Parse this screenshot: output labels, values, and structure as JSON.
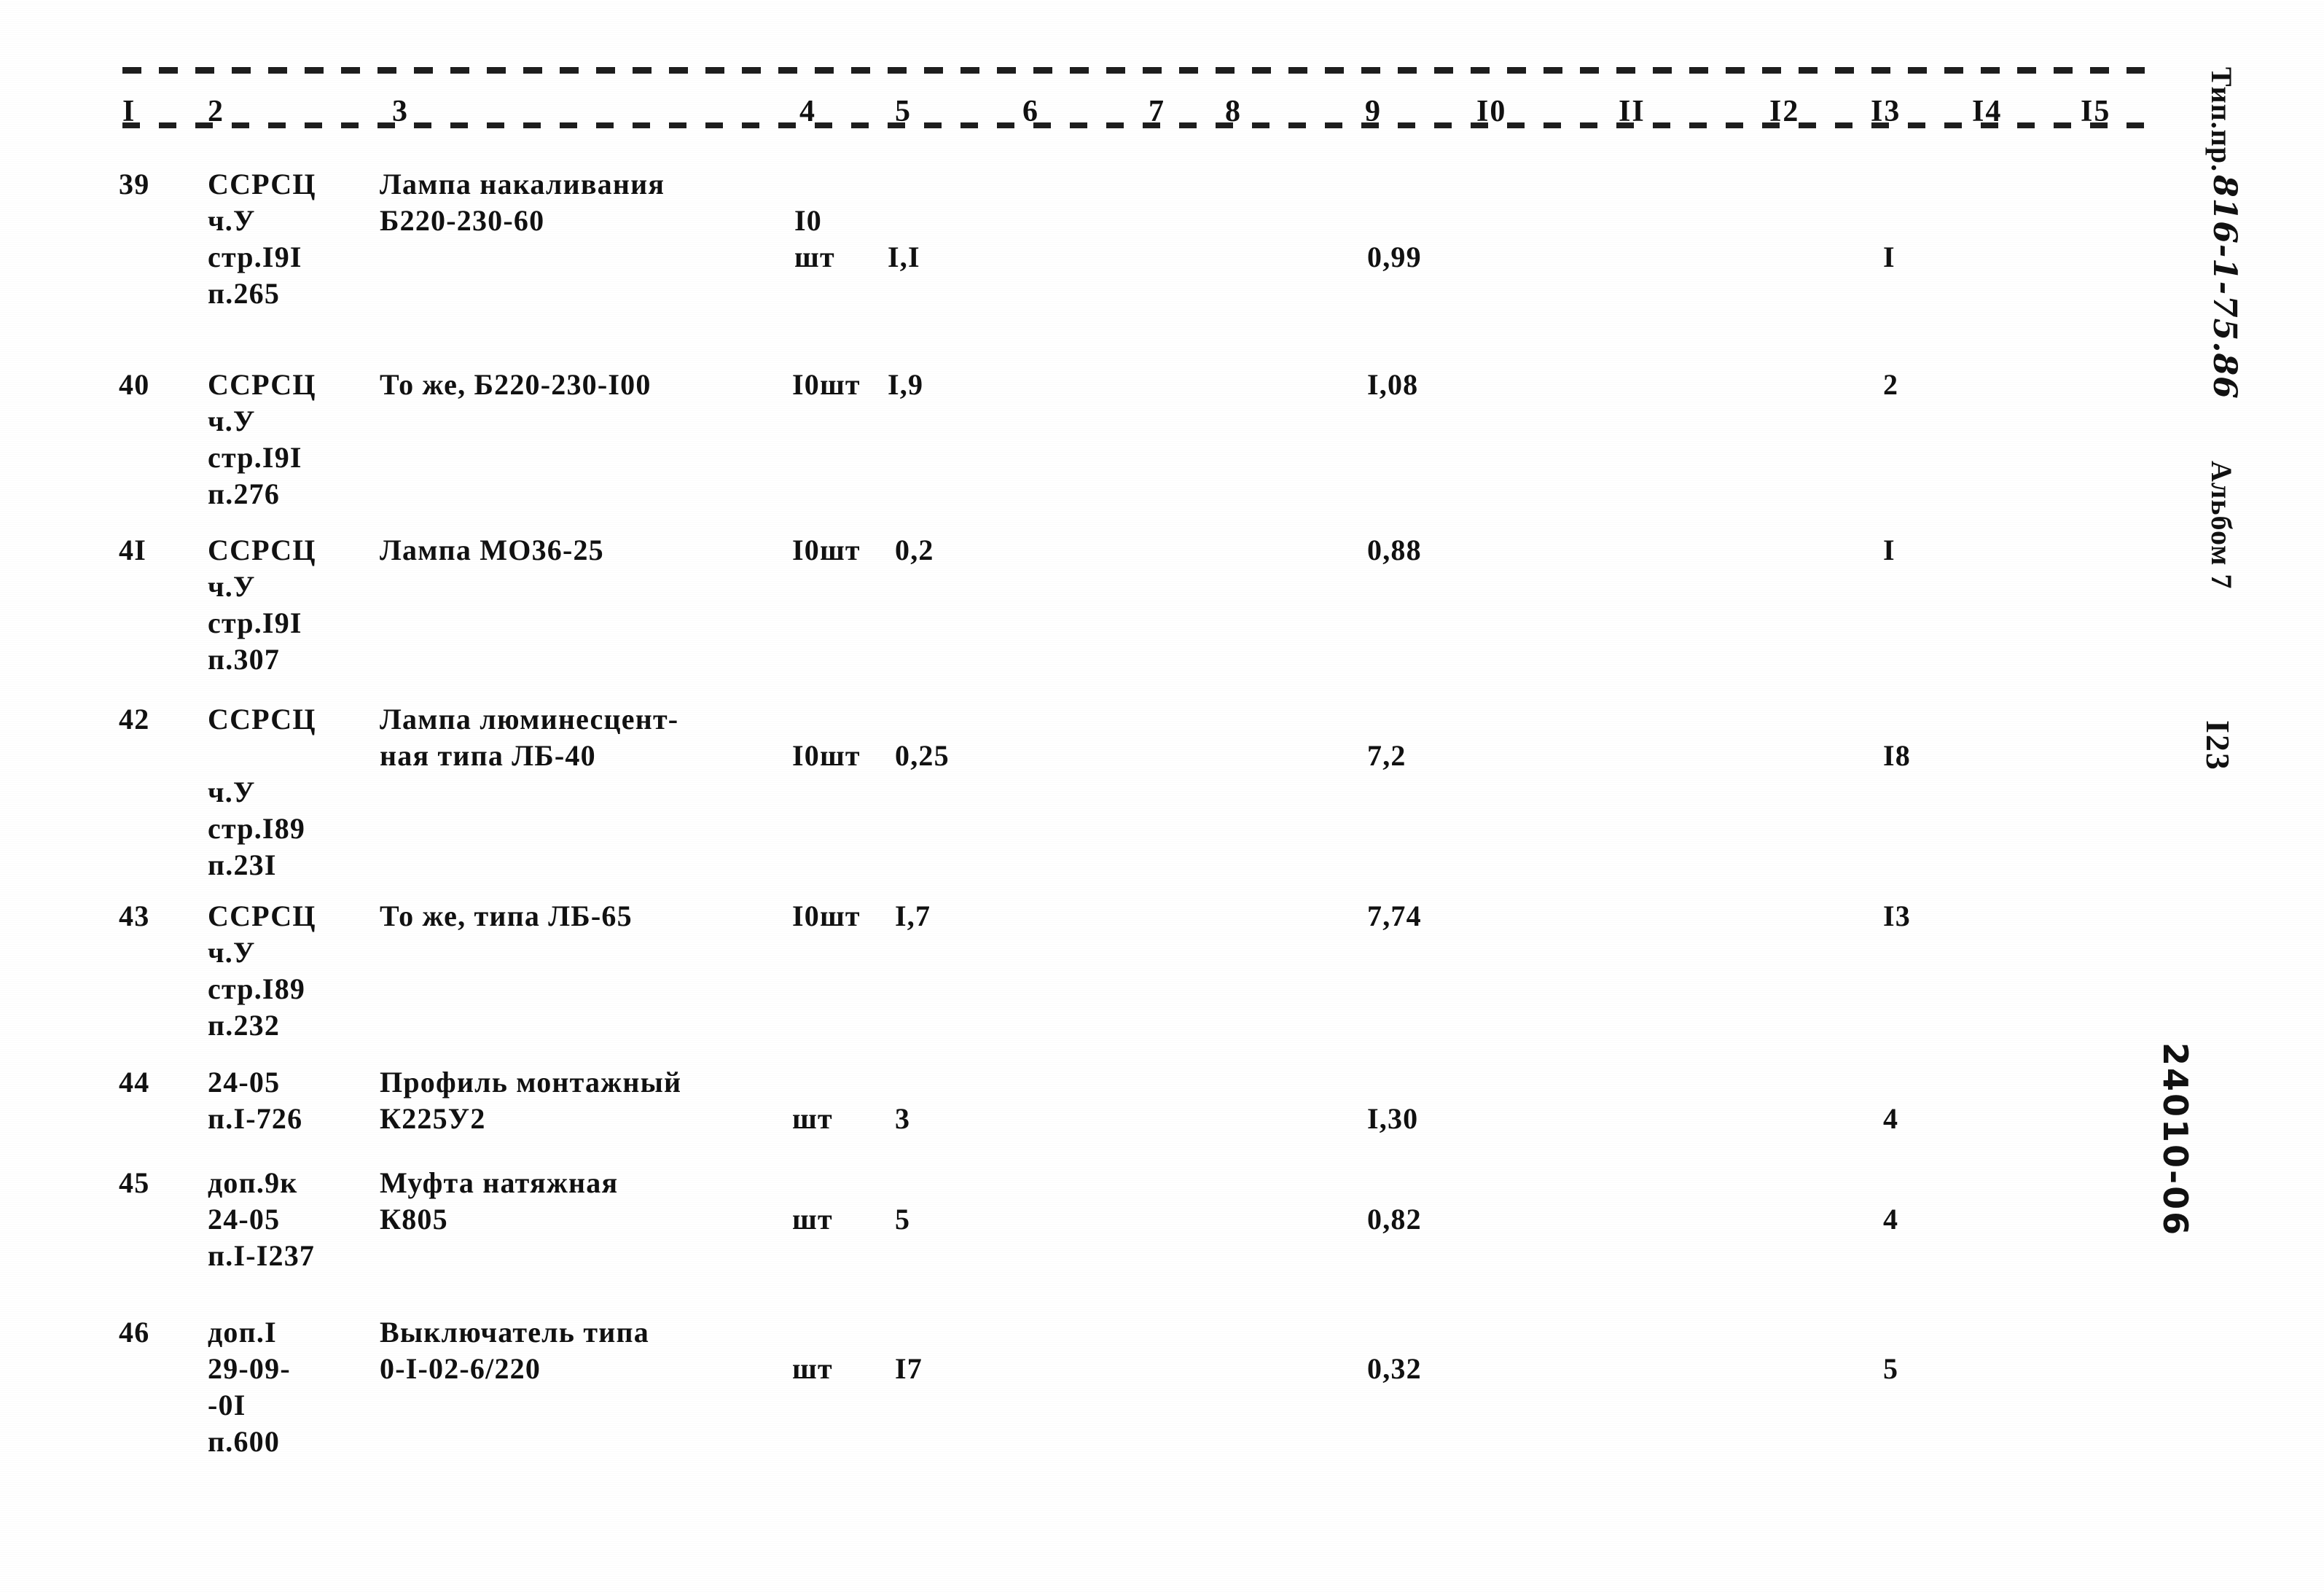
{
  "document": {
    "page_number": "I23",
    "margin_stamp_typed": "Тип.пр.",
    "margin_stamp_hand": "816-1-75.86",
    "margin_album": "Альбом 7",
    "margin_code": "24010-06"
  },
  "table": {
    "column_headers": [
      "I",
      "2",
      "3",
      "4",
      "5",
      "6",
      "7",
      "8",
      "9",
      "I0",
      "II",
      "I2",
      "I3",
      "I4",
      "I5"
    ],
    "rows": [
      {
        "num": "39",
        "ref": "ССРСЦ\nч.У\nстр.I9I\nп.265",
        "name": "Лампа накаливания\nБ220-230-60",
        "unit": "I0\nшт",
        "qty": "I,I",
        "col9": "0,99",
        "col13": "I"
      },
      {
        "num": "40",
        "ref": "ССРСЦ\nч.У\nстр.I9I\nп.276",
        "name": "То же, Б220-230-I00",
        "unit": "I0шт",
        "qty": "I,9",
        "col9": "I,08",
        "col13": "2"
      },
      {
        "num": "4I",
        "ref": "ССРСЦ\nч.У\nстр.I9I\nп.307",
        "name": "Лампа МО36-25",
        "unit": "I0шт",
        "qty": "0,2",
        "col9": "0,88",
        "col13": "I"
      },
      {
        "num": "42",
        "ref": "ССРСЦ\n\nч.У\nстр.I89\nп.23I",
        "name": "Лампа люминесцент-\nная типа ЛБ-40",
        "unit": "I0шт",
        "qty": "0,25",
        "col9": "7,2",
        "col13": "I8"
      },
      {
        "num": "43",
        "ref": "ССРСЦ\nч.У\nстр.I89\nп.232",
        "name": "То же, типа ЛБ-65",
        "unit": "I0шт",
        "qty": "I,7",
        "col9": "7,74",
        "col13": "I3"
      },
      {
        "num": "44",
        "ref": "24-05\nп.I-726",
        "name": "Профиль монтажный\nК225У2",
        "unit": "шт",
        "qty": "3",
        "col9": "I,30",
        "col13": "4"
      },
      {
        "num": "45",
        "ref": "доп.9к\n24-05\nп.I-I237",
        "name": "Муфта натяжная\nК805",
        "unit": "шт",
        "qty": "5",
        "col9": "0,82",
        "col13": "4"
      },
      {
        "num": "46",
        "ref": "доп.I\n29-09-\n-0I\nп.600",
        "name": "Выключатель типа\n0-I-02-6/220",
        "unit": "шт",
        "qty": "I7",
        "col9": "0,32",
        "col13": "5"
      }
    ]
  }
}
